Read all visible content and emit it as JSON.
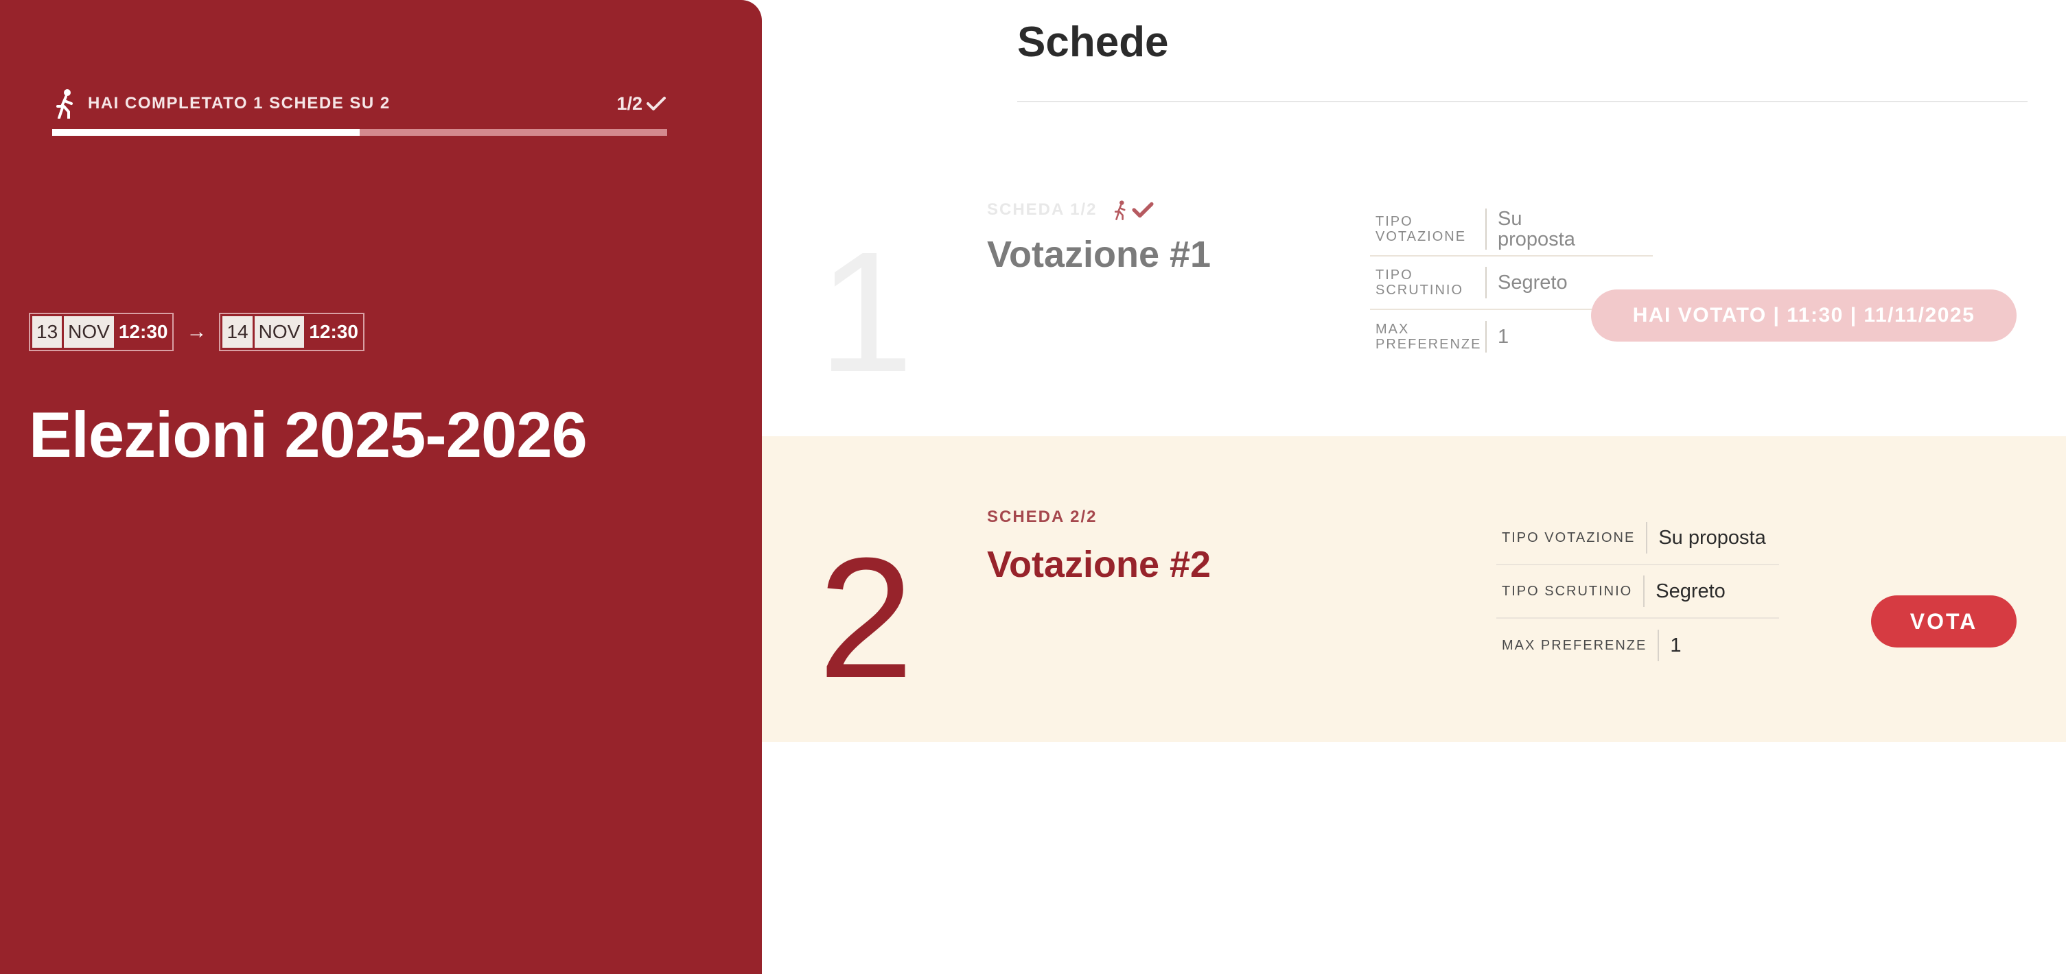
{
  "colors": {
    "brand": "#97232b",
    "accent": "#d63b42",
    "voted_button": "#f2c9cb",
    "active_row_bg": "#fcf4e6"
  },
  "sidebar": {
    "progress": {
      "icon": "walker-icon",
      "text": "HAI COMPLETATO 1 SCHEDE SU 2",
      "count": "1/2",
      "count_icon": "check-icon",
      "value": 0.5
    },
    "date_range": {
      "start": {
        "day": "13",
        "month": "NOV",
        "time": "12:30"
      },
      "arrow": "→",
      "end": {
        "day": "14",
        "month": "NOV",
        "time": "12:30"
      }
    },
    "election_title": "Elezioni 2025-2026"
  },
  "main": {
    "title": "Schede",
    "ballots": [
      {
        "number": "1",
        "kicker": "SCHEDA 1/2",
        "status_icons": [
          "walker-icon",
          "check-icon"
        ],
        "name": "Votazione #1",
        "info": [
          {
            "label": "TIPO VOTAZIONE",
            "value": "Su proposta"
          },
          {
            "label": "TIPO SCRUTINIO",
            "value": "Segreto"
          },
          {
            "label": "MAX PREFERENZE",
            "value": "1"
          }
        ],
        "action_label": "HAI VOTATO | 11:30 | 11/11/2025",
        "action_state": "disabled"
      },
      {
        "number": "2",
        "kicker": "SCHEDA 2/2",
        "name": "Votazione #2",
        "info": [
          {
            "label": "TIPO VOTAZIONE",
            "value": "Su proposta"
          },
          {
            "label": "TIPO SCRUTINIO",
            "value": "Segreto"
          },
          {
            "label": "MAX PREFERENZE",
            "value": "1"
          }
        ],
        "action_label": "VOTA",
        "action_state": "enabled"
      }
    ]
  }
}
